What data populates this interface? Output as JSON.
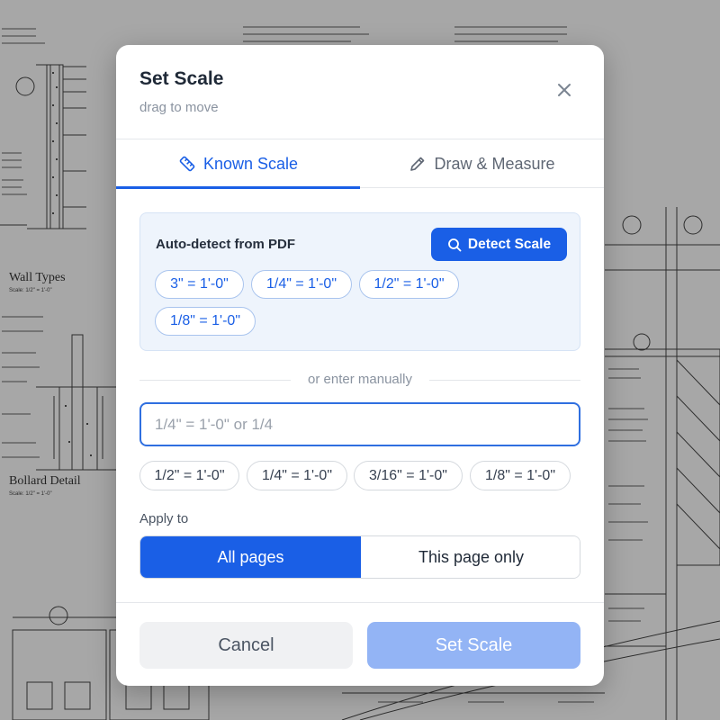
{
  "background": {
    "titles": [
      "Wall Types",
      "Bollard Detail"
    ],
    "scale_notes": [
      "Scale: 1/2\" = 1'-0\"",
      "Scale: 1/2\" = 1'-0\""
    ]
  },
  "dialog": {
    "title": "Set Scale",
    "subtitle": "drag to move",
    "close_icon": "close-icon"
  },
  "tabs": [
    {
      "label": "Known Scale",
      "icon": "ruler-icon",
      "active": true
    },
    {
      "label": "Draw & Measure",
      "icon": "pencil-icon",
      "active": false
    }
  ],
  "auto_detect": {
    "label": "Auto-detect from PDF",
    "button_label": "Detect Scale",
    "button_icon": "search-icon",
    "suggestions": [
      "3\" = 1'-0\"",
      "1/4\" = 1'-0\"",
      "1/2\" = 1'-0\"",
      "1/8\" = 1'-0\""
    ]
  },
  "manual": {
    "divider_text": "or enter manually",
    "input_value": "",
    "input_placeholder": "1/4\" = 1'-0\" or 1/4",
    "presets": [
      "1/2\" = 1'-0\"",
      "1/4\" = 1'-0\"",
      "3/16\" = 1'-0\"",
      "1/8\" = 1'-0\""
    ]
  },
  "apply_to": {
    "label": "Apply to",
    "options": [
      "All pages",
      "This page only"
    ],
    "selected": "All pages"
  },
  "footer": {
    "cancel_label": "Cancel",
    "submit_label": "Set Scale"
  },
  "colors": {
    "accent": "#1a5fe6",
    "submit_disabled": "#93b4f5",
    "auto_box_bg": "#eef4fc"
  }
}
